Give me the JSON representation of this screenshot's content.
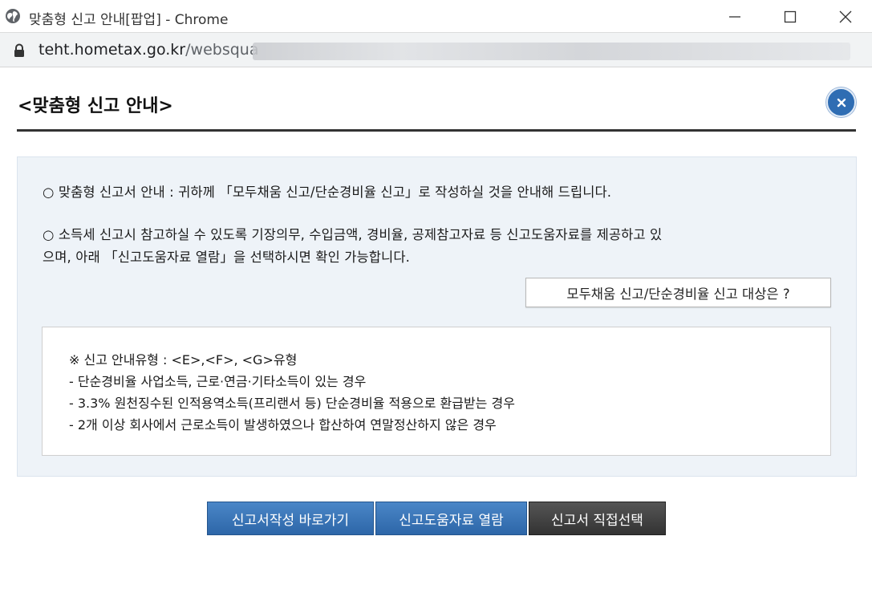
{
  "window": {
    "title": "맞춤형 신고 안내[팝업] - Chrome"
  },
  "addressbar": {
    "host": "teht.hometax.go.kr",
    "path_visible": "/websqua"
  },
  "popup": {
    "title": "<맞춤형 신고 안내>",
    "info_lines": [
      "○ 맞춤형 신고서 안내 : 귀하께 「모두채움 신고/단순경비율 신고」로 작성하실 것을 안내해 드립니다.",
      "○ 소득세 신고시 참고하실 수 있도록 기장의무, 수입금액, 경비율, 공제참고자료 등 신고도움자료를 제공하고 있",
      "으며, 아래 「신고도움자료 열람」을 선택하시면 확인 가능합니다."
    ],
    "target_button_label": "모두채움 신고/단순경비율 신고 대상은 ?",
    "guide": {
      "heading": "※ 신고 안내유형 : <E>,<F>, <G>유형",
      "items": [
        "- 단순경비율 사업소득, 근로·연금·기타소득이 있는 경우",
        "- 3.3% 원천징수된 인적용역소득(프리랜서 등) 단순경비율 적용으로 환급받는 경우",
        "- 2개 이상 회사에서 근로소득이 발생하였으나 합산하여 연말정산하지 않은 경우"
      ]
    },
    "buttons": {
      "write": "신고서작성 바로가기",
      "view_help": "신고도움자료 열람",
      "direct_select": "신고서 직접선택"
    }
  },
  "colors": {
    "primary_button": "#2d66a8",
    "dark_button": "#333333",
    "close_circle": "#2f6db3",
    "panel_bg": "#eef3f8"
  },
  "icons": {
    "globe": "globe-icon",
    "lock": "lock-icon",
    "close": "close-icon"
  }
}
